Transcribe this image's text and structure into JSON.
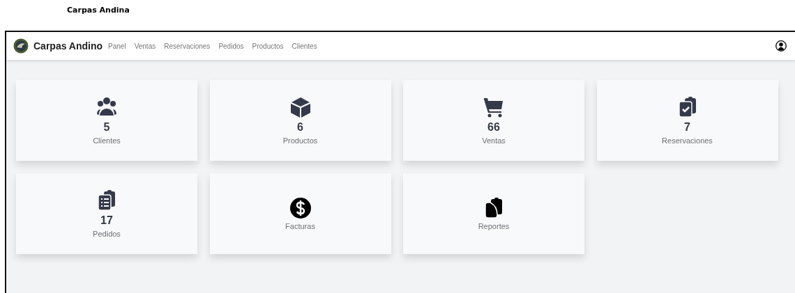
{
  "page_title": "Carpas Andina",
  "navbar": {
    "brand": "Carpas Andino",
    "links": [
      "Panel",
      "Ventas",
      "Reservaciones",
      "Pedidos",
      "Productos",
      "Clientes"
    ]
  },
  "cards": [
    {
      "count": "5",
      "label": "Clientes"
    },
    {
      "count": "6",
      "label": "Productos"
    },
    {
      "count": "66",
      "label": "Ventas"
    },
    {
      "count": "7",
      "label": "Reservaciones"
    },
    {
      "count": "17",
      "label": "Pedidos"
    },
    {
      "label": "Facturas"
    },
    {
      "label": "Reportes"
    }
  ]
}
